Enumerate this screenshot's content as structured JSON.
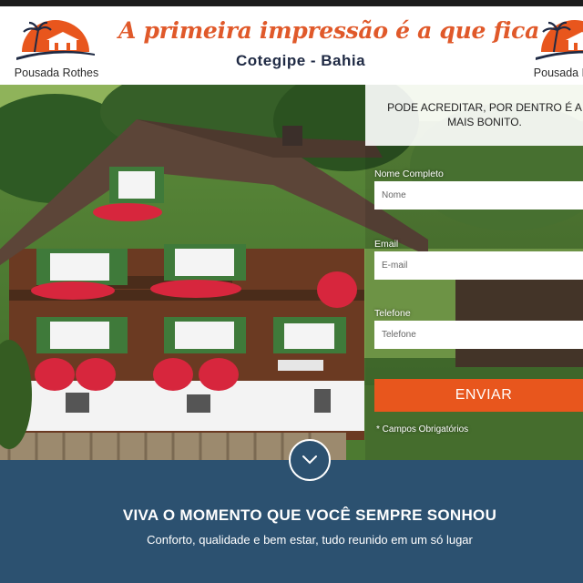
{
  "header": {
    "brand": "Pousada Rothes",
    "tagline": "A primeira impressão é a que fica",
    "location": "Cotegipe - Bahia",
    "colors": {
      "accent": "#e0592a",
      "location_text": "#1f2a44"
    }
  },
  "form": {
    "heading_line1": "PODE ACREDITAR, POR DENTRO É A",
    "heading_line2": "MAIS BONITO.",
    "fields": [
      {
        "label": "Nome Completo",
        "placeholder": "Nome",
        "value": ""
      },
      {
        "label": "Email",
        "placeholder": "E-mail",
        "value": ""
      },
      {
        "label": "Telefone",
        "placeholder": "Telefone",
        "value": ""
      }
    ],
    "submit_label": "ENVIAR",
    "required_note": "* Campos Obrigatórios",
    "colors": {
      "button": "#e8561d"
    }
  },
  "scroll": {
    "icon": "chevron-down-icon"
  },
  "section": {
    "headline": "VIVA O MOMENTO QUE VOCÊ SEMPRE SONHOU",
    "subline": "Conforto, qualidade e bem estar, tudo reunido em um só lugar",
    "colors": {
      "background": "#2c5170"
    }
  }
}
